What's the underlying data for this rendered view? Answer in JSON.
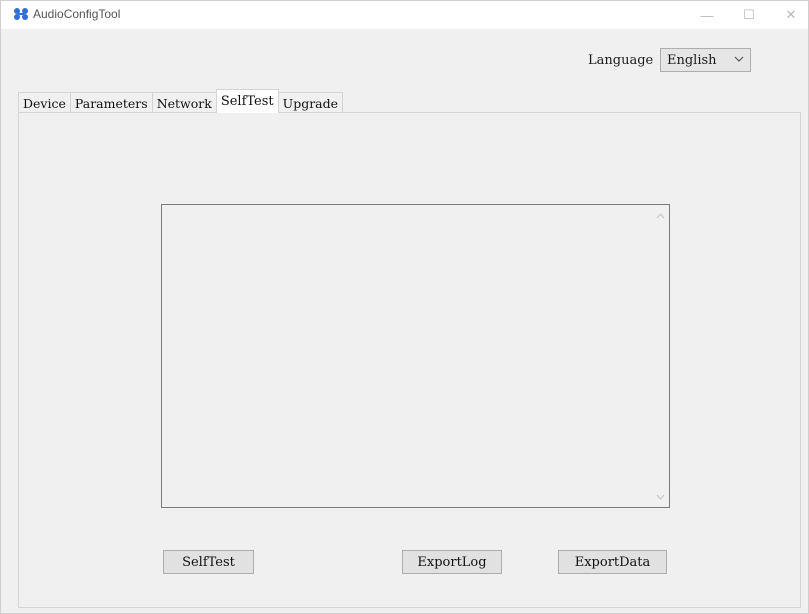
{
  "window": {
    "title": "AudioConfigTool",
    "controls": {
      "minimize": "—",
      "maximize": "☐",
      "close": "✕"
    }
  },
  "language": {
    "label": "Language",
    "selected": "English"
  },
  "tabs": [
    {
      "label": "Device"
    },
    {
      "label": "Parameters"
    },
    {
      "label": "Network"
    },
    {
      "label": "SelfTest",
      "active": true
    },
    {
      "label": "Upgrade"
    }
  ],
  "log": {
    "content": ""
  },
  "buttons": {
    "selftest": "SelfTest",
    "export_log": "ExportLog",
    "export_data": "ExportData"
  },
  "icons": {
    "app": "audio-config-icon",
    "dropdown": "chevron-down-icon",
    "scroll_up": "scroll-up-arrow-icon",
    "scroll_down": "scroll-down-arrow-icon"
  },
  "colors": {
    "app_icon": "#2f6fd6",
    "window_bg": "#f0f0f0",
    "button_bg": "#e1e1e1"
  }
}
